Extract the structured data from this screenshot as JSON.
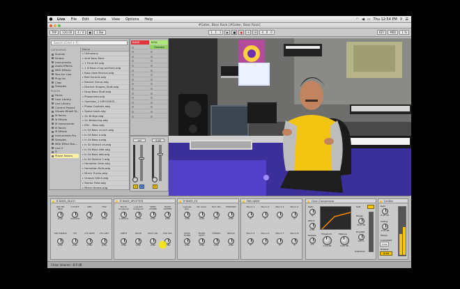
{
  "menubar": {
    "items": [
      "Live",
      "File",
      "Edit",
      "Create",
      "View",
      "Options",
      "Help"
    ],
    "clock": "Thu 12:54 PM"
  },
  "window": {
    "title": "#Gater, Bass Rack  [#Gater, Bass Rack]"
  },
  "transport": {
    "tap": "TAP",
    "tempo": "120.00",
    "signature": "4 / 4",
    "quantize": "1 Bar",
    "position": "1 . 1 . 1",
    "loop_length": "4 . 0 . 0",
    "key": "KEY",
    "midi": "MIDI",
    "cpu": "1 %"
  },
  "browser": {
    "search_placeholder": "Search (Cmd + F)",
    "categories_header": "CATEGORIES",
    "categories": [
      "Sounds",
      "Drums",
      "Instruments",
      "Audio Effects",
      "MIDI Effects",
      "Max for Live",
      "Plug-ins",
      "Clips",
      "Samples"
    ],
    "places_header": "PLACES",
    "places": [
      "Packs",
      "User Library",
      "Live Library",
      "Current Project",
      "Visuals Wheel M...",
      "M Racks",
      "M Effects",
      "M Instruments",
      "M Racks",
      "M Effects",
      "Instruments Pro",
      "Samples",
      "MIDI Effect Rac...",
      "Live 9",
      "FI",
      "Player Basics"
    ],
    "files_header": "Name",
    "files": [
      "Unknowny",
      "Acid Bass Rack",
      "1 Fill at 80 adg",
      "1 Ill Bass chug perform.adg",
      "Bass Stab Revival.adg",
      "Bed Sounds.adg",
      "Bassist Group.adg",
      "Distinct Shapes_Stutt.adg",
      "Drop Bass Stutt.adg",
      "Phaserized.adg",
      "Operator_1.LMO10005...",
      "Phase Controls.adg",
      "Spoon back.adg",
      "Gn Bridge.adg",
      "Gn Balancing.adg",
      "EDL - Bass.adg",
      "In Gt Bass crunch.adg",
      "In Gt Bass a.adg",
      "In Gt Bass a.adg",
      "In Gt Stretch ch.adg",
      "In Gt Bass side.adg",
      "In Gt Bass ebb.adg",
      "In Gt Stretch 2.adg",
      "Hemotion Inter.adg",
      "Hemotion Rolls.adg",
      "Mirror Trucks.adg",
      "Groove Glitch.adg",
      "Stereo Field.adg",
      "Mirror theme.adg",
      "Octopal Wiz.adg"
    ]
  },
  "session": {
    "tracks": [
      "BASS",
      "KICK"
    ],
    "clip_name": "Ostinato",
    "volume_1": "-inf",
    "volume_2": "0.00",
    "track_numbers": [
      "1",
      "2"
    ],
    "solo": "S"
  },
  "racks": [
    {
      "title": "ff BASS_MULTI",
      "macros": [
        {
          "label": "OSC BR Pitch",
          "value": "0.00"
        },
        {
          "label": "CUTOFF",
          "value": "70.5 kHz"
        },
        {
          "label": "RES",
          "value": "0.00"
        },
        {
          "label": "FMV",
          "value": "0.00"
        },
        {
          "label": "TOP MIDDLE",
          "value": "0.00"
        },
        {
          "label": "FM",
          "value": "0.00"
        },
        {
          "label": "LFO RATE",
          "value": "0.00"
        },
        {
          "label": "LFO AMT",
          "value": "0.00"
        }
      ]
    },
    {
      "title": "ff BASS_SPLITTER",
      "macros": [
        {
          "label": "Mid-Hi Crossover",
          "value": "1.40 kHz"
        },
        {
          "label": "Low-Mid Crossover",
          "value": "50 Hz"
        },
        {
          "label": "SEND CHAMP",
          "value": "0.00"
        },
        {
          "label": "MONO LIMITER",
          "value": "0.00"
        },
        {
          "label": "CREST",
          "value": "0.00"
        },
        {
          "label": "DRIVE",
          "value": "0.00"
        },
        {
          "label": "HIGH VOL",
          "value": "0.00"
        },
        {
          "label": "MID VOL",
          "value": "0.00"
        }
      ]
    },
    {
      "title": "ff BASS_FX",
      "macros": [
        {
          "label": "Lowside Gen.",
          "value": "0.00"
        },
        {
          "label": "Stt. Ampl.",
          "value": "0.00"
        },
        {
          "label": "Port. Mix",
          "value": "0.00"
        },
        {
          "label": "FORMANT",
          "value": "0.00"
        },
        {
          "label": "MULTI FILTER",
          "value": "0.00"
        },
        {
          "label": "FILTER SHIFT",
          "value": "0.00"
        },
        {
          "label": "STEREO",
          "value": "0.00"
        },
        {
          "label": "REDUX",
          "value": "0.00"
        }
      ]
    },
    {
      "title": "FAR AWAY",
      "macros": [
        {
          "label": "Macro 1",
          "value": "0"
        },
        {
          "label": "Macro 2",
          "value": "0"
        },
        {
          "label": "Macro 3",
          "value": "0"
        },
        {
          "label": "Macro 4",
          "value": "0"
        },
        {
          "label": "Macro 5",
          "value": "0"
        },
        {
          "label": "Macro 6",
          "value": "0"
        },
        {
          "label": "Macro 7",
          "value": "0"
        },
        {
          "label": "Macro 8",
          "value": "0"
        }
      ]
    }
  ],
  "compressor": {
    "title": "Glue Compressor",
    "ratio_label": "Ratio",
    "ratio": "4",
    "attack_label": "Attack",
    "attack": "0.30",
    "release_label": "Release",
    "release": "0.2",
    "threshold_label": "Threshold",
    "threshold": "-17.0 dB",
    "makeup_label": "Makeup",
    "makeup": "0.00 dB",
    "range_label": "Range",
    "range": "50.0 dB",
    "dry_wet_label": "Dry/Wet",
    "dry_wet": "100 %",
    "soft_label": "Soft",
    "sidechain": "Sidechain"
  },
  "limiter": {
    "title": "Limiter",
    "gain_label": "Gain",
    "gain": "0.00 dB",
    "ceiling_label": "Ceiling",
    "ceiling": "-0.30 dB",
    "lookahead_label": "Lookahead",
    "lookahead": "3 ms",
    "release_label": "Release",
    "release": "300 ms",
    "auto": "Auto",
    "stereo": "Stereo"
  },
  "statusbar": {
    "text": "Chain Volume: -8.9 dB"
  }
}
